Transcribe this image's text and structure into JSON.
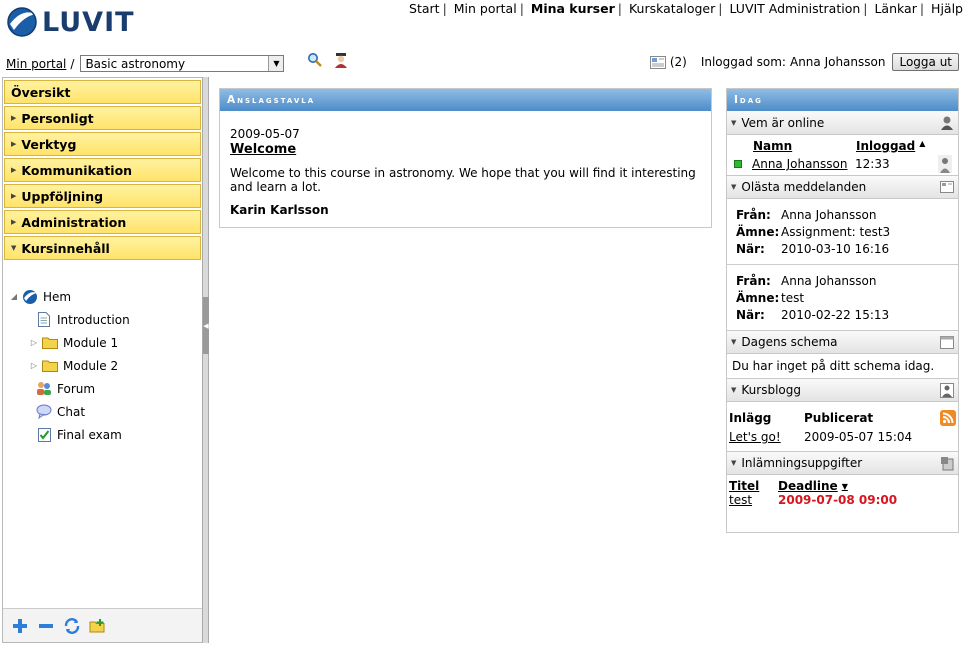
{
  "app": {
    "logo_text": "LUVIT"
  },
  "topnav": {
    "items": [
      {
        "label": "Start",
        "active": false
      },
      {
        "label": "Min portal",
        "active": false
      },
      {
        "label": "Mina kurser",
        "active": true
      },
      {
        "label": "Kurskataloger",
        "active": false
      },
      {
        "label": "LUVIT Administration",
        "active": false
      },
      {
        "label": "Länkar",
        "active": false
      },
      {
        "label": "Hjälp",
        "active": false
      }
    ]
  },
  "breadcrumb": {
    "root": "Min portal",
    "sep": "/",
    "course": "Basic astronomy"
  },
  "userbar": {
    "messages_count": "(2)",
    "logged_in_label": "Inloggad som:",
    "user": "Anna Johansson",
    "logout": "Logga ut"
  },
  "left_menu": {
    "items": [
      {
        "label": "Översikt",
        "arrow": ""
      },
      {
        "label": "Personligt",
        "arrow": "right"
      },
      {
        "label": "Verktyg",
        "arrow": "right"
      },
      {
        "label": "Kommunikation",
        "arrow": "right"
      },
      {
        "label": "Uppföljning",
        "arrow": "right"
      },
      {
        "label": "Administration",
        "arrow": "right"
      },
      {
        "label": "Kursinnehåll",
        "arrow": "down"
      }
    ]
  },
  "tree": {
    "root": "Hem",
    "items": [
      {
        "label": "Introduction",
        "icon": "page-icon"
      },
      {
        "label": "Module 1",
        "icon": "folder-icon"
      },
      {
        "label": "Module 2",
        "icon": "folder-icon"
      },
      {
        "label": "Forum",
        "icon": "forum-icon"
      },
      {
        "label": "Chat",
        "icon": "chat-icon"
      },
      {
        "label": "Final exam",
        "icon": "exam-icon"
      }
    ]
  },
  "board": {
    "header": "Anslagstavla",
    "date": "2009-05-07",
    "title": "Welcome",
    "text": "Welcome to this course in astronomy. We hope that you will find it interesting and learn a lot.",
    "author": "Karin Karlsson"
  },
  "today": {
    "header": "Idag",
    "online": {
      "title": "Vem är online",
      "col_name": "Namn",
      "col_login": "Inloggad",
      "rows": [
        {
          "name": "Anna Johansson",
          "time": "12:33"
        }
      ]
    },
    "unread": {
      "title": "Olästa meddelanden",
      "from_label": "Från:",
      "subject_label": "Ämne:",
      "when_label": "När:",
      "messages": [
        {
          "from": "Anna Johansson",
          "subject": "Assignment: test3",
          "when": "2010-03-10 16:16"
        },
        {
          "from": "Anna Johansson",
          "subject": "test",
          "when": "2010-02-22 15:13"
        }
      ]
    },
    "schedule": {
      "title": "Dagens schema",
      "empty_text": "Du har inget på ditt schema idag."
    },
    "blog": {
      "title": "Kursblogg",
      "col_post": "Inlägg",
      "col_published": "Publicerat",
      "rows": [
        {
          "post": "Let's go!",
          "published": "2009-05-07 15:04"
        }
      ]
    },
    "assignments": {
      "title": "Inlämningsuppgifter",
      "col_title": "Titel",
      "col_deadline": "Deadline",
      "rows": [
        {
          "title": "test",
          "deadline": "2009-07-08 09:00"
        }
      ],
      "deadline_color": "#d8141e"
    }
  },
  "colors": {
    "menu_bg": "#ffe36a",
    "header_blue": "#4d8cc8",
    "online_green": "#2dbb2d"
  }
}
